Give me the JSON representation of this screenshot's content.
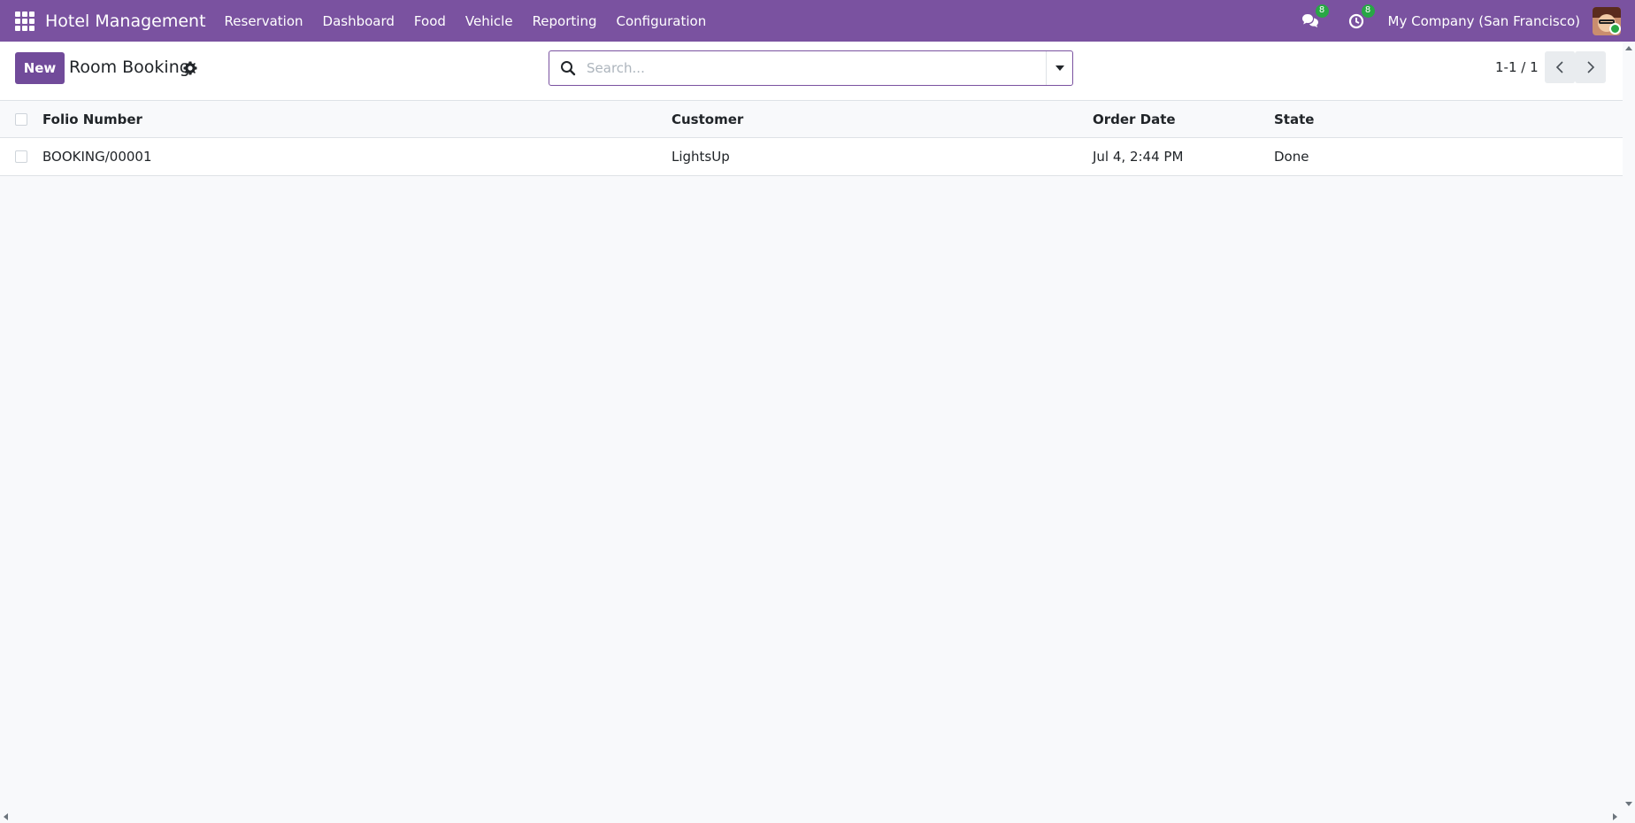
{
  "navbar": {
    "app_title": "Hotel Management",
    "menu": [
      "Reservation",
      "Dashboard",
      "Food",
      "Vehicle",
      "Reporting",
      "Configuration"
    ],
    "messages_count": "8",
    "activities_count": "8",
    "company": "My Company (San Francisco)",
    "color": "#7a52a0"
  },
  "control": {
    "new_label": "New",
    "title": "Room Booking",
    "search_placeholder": "Search...",
    "pager": "1-1 / 1",
    "accent": "#714b9a"
  },
  "table": {
    "columns": [
      "Folio Number",
      "Customer",
      "Order Date",
      "State"
    ],
    "rows": [
      [
        "BOOKING/00001",
        "LightsUp",
        "Jul 4, 2:44 PM",
        "Done"
      ]
    ]
  },
  "icons": [
    "apps-grid-icon",
    "gear-icon",
    "search-icon",
    "chevron-left-icon",
    "chevron-right-icon",
    "chat-icon",
    "clock-icon"
  ]
}
